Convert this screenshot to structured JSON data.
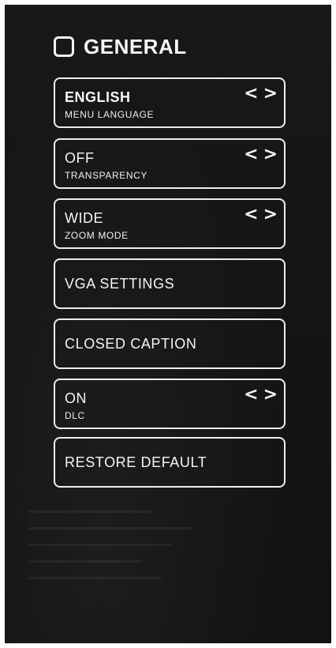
{
  "header": {
    "title": "GENERAL"
  },
  "items": [
    {
      "value": "ENGLISH",
      "sub": "MENU LANGUAGE",
      "has_arrows": true
    },
    {
      "value": "OFF",
      "sub": "TRANSPARENCY",
      "has_arrows": true
    },
    {
      "value": "WIDE",
      "sub": "ZOOM MODE",
      "has_arrows": true
    },
    {
      "label": "VGA SETTINGS"
    },
    {
      "label": "CLOSED CAPTION"
    },
    {
      "value": "ON",
      "sub": "DLC",
      "has_arrows": true
    },
    {
      "label": "RESTORE DEFAULT"
    }
  ],
  "arrows": {
    "left": "<",
    "right": ">"
  },
  "colors": {
    "background": "#161616",
    "foreground": "#f5f5f5",
    "border": "#eeeeee"
  }
}
